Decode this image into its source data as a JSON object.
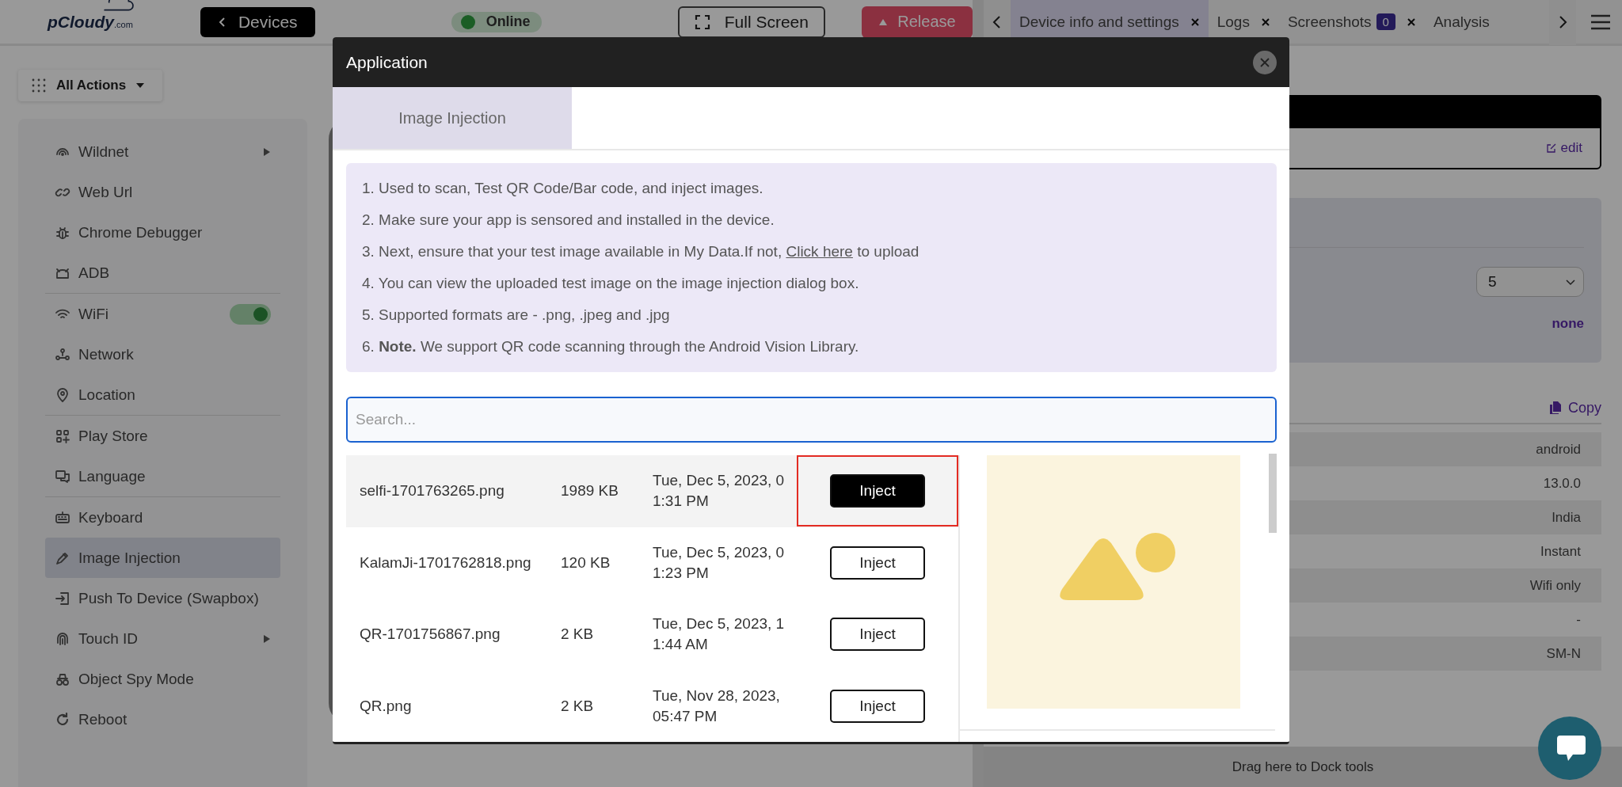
{
  "top_bar": {
    "logo": "pCloudy",
    "logo_suffix": ".com",
    "back_button": "Devices",
    "status": {
      "label": "Online",
      "online": true
    },
    "full_screen_button": "Full Screen",
    "release_button": "Release"
  },
  "actions_menu": {
    "label": "All Actions",
    "groups": [
      {
        "items": [
          {
            "label": "Wildnet",
            "kind": "submenu",
            "selected": false
          },
          {
            "label": "Web Url",
            "kind": "plain",
            "selected": false
          },
          {
            "label": "Chrome Debugger",
            "kind": "plain",
            "selected": false
          },
          {
            "label": "ADB",
            "kind": "plain",
            "selected": false
          }
        ]
      },
      {
        "items": [
          {
            "label": "WiFi",
            "kind": "toggle",
            "on": true,
            "selected": false
          },
          {
            "label": "Network",
            "kind": "plain",
            "selected": false
          },
          {
            "label": "Location",
            "kind": "plain",
            "selected": false
          }
        ]
      },
      {
        "items": [
          {
            "label": "Play Store",
            "kind": "plain",
            "selected": false
          },
          {
            "label": "Language",
            "kind": "plain",
            "selected": false
          }
        ]
      },
      {
        "items": [
          {
            "label": "Keyboard",
            "kind": "plain",
            "selected": false
          },
          {
            "label": "Image Injection",
            "kind": "plain",
            "selected": true
          },
          {
            "label": "Push To Device (Swapbox)",
            "kind": "plain",
            "selected": false
          },
          {
            "label": "Touch ID",
            "kind": "submenu",
            "selected": false
          },
          {
            "label": "Object Spy Mode",
            "kind": "plain",
            "selected": false
          },
          {
            "label": "Reboot",
            "kind": "plain",
            "selected": false
          }
        ]
      }
    ]
  },
  "right_panel": {
    "tabs": [
      {
        "label": "Device info and settings",
        "selected": true
      },
      {
        "label": "Logs",
        "selected": false
      },
      {
        "label": "Screenshots",
        "badge": "0",
        "selected": false
      },
      {
        "label": "Analysis",
        "selected": false
      }
    ],
    "edit_link": "edit",
    "select_value": "5",
    "none_value": "none",
    "copy_link": "Copy",
    "info_values": [
      "android",
      "13.0.0",
      "India",
      "Instant",
      "Wifi only",
      "-",
      "SM-N"
    ],
    "dock_hint": "Drag here to Dock tools"
  },
  "dialog": {
    "title": "Application",
    "tabs": [
      {
        "label": "Image Injection",
        "selected": true
      }
    ],
    "instructions": [
      {
        "text": "1. Used to scan, Test QR Code/Bar code, and inject images."
      },
      {
        "text": "2. Make sure your app is sensored and installed in the device."
      },
      {
        "text": "3. Next, ensure that your test image available in My Data.If not,",
        "link": "Click here",
        "after": "to upload"
      },
      {
        "text": "4. You can view the uploaded test image on the image injection dialog box."
      },
      {
        "text": "5. Supported formats are - .png, .jpeg and .jpg"
      },
      {
        "text": "6. **Note.** We support QR code scanning through the Android Vision Library."
      }
    ],
    "search": {
      "placeholder": "Search..."
    },
    "files": [
      {
        "name": "selfi-1701763265.png",
        "size": "1989 KB",
        "date": "Tue, Dec 5, 2023, 01:31 PM",
        "action": "Inject",
        "selected": true,
        "outlined": true
      },
      {
        "name": "KalamJi-1701762818.png",
        "size": "120 KB",
        "date": "Tue, Dec 5, 2023, 01:23 PM",
        "action": "Inject",
        "selected": false,
        "outlined": false
      },
      {
        "name": "QR-1701756867.png",
        "size": "2 KB",
        "date": "Tue, Dec 5, 2023, 11:44 AM",
        "action": "Inject",
        "selected": false,
        "outlined": false
      },
      {
        "name": "QR.png",
        "size": "2 KB",
        "date": "Tue, Nov 28, 2023, 05:47 PM",
        "action": "Inject",
        "selected": false,
        "outlined": false
      }
    ]
  }
}
